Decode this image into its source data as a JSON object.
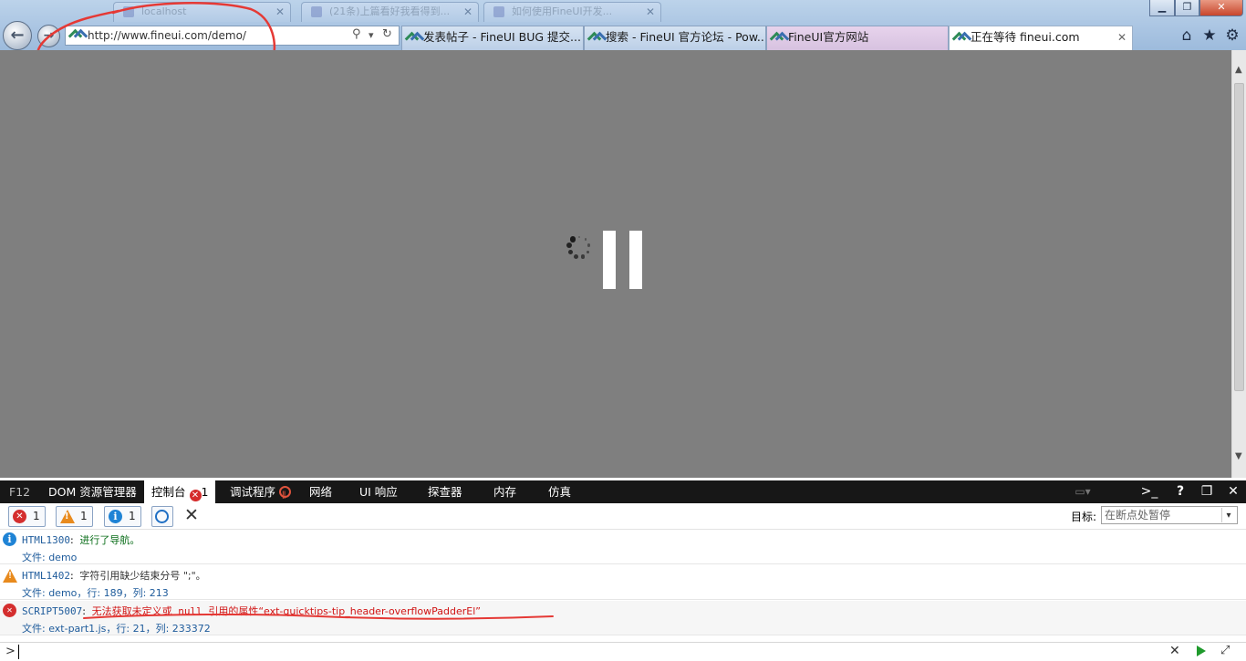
{
  "window": {
    "minimize_glyph": "▁",
    "restore_glyph": "❐",
    "close_glyph": "✕"
  },
  "background_tabs": [
    {
      "label": "localhost"
    },
    {
      "label": "(21条)上篇看好我看得到..."
    },
    {
      "label": "如何使用FineUI开发..."
    }
  ],
  "address_bar": {
    "url": "http://www.fineui.com/demo/",
    "search_glyph": "⚲",
    "dropdown_glyph": "▾",
    "refresh_glyph": "↻"
  },
  "tabs": [
    {
      "label": "发表帖子 - FineUI BUG 提交..."
    },
    {
      "label": "搜索 - FineUI 官方论坛 - Pow..."
    },
    {
      "label": "FineUI官方网站"
    },
    {
      "label": "正在等待 fineui.com",
      "close": "✕"
    }
  ],
  "toolbar_icons": {
    "home": "⌂",
    "favorites": "★",
    "tools": "⚙"
  },
  "colors": {
    "page_overlay": "#7f7f7f",
    "error": "#d42e2e",
    "warning": "#e88a1d",
    "info": "#1f83d5",
    "annotation": "#e53935"
  },
  "devtools": {
    "tabs": {
      "f12": "F12",
      "dom": "DOM 资源管理器",
      "console": "控制台",
      "console_errors": "1",
      "debugger": "调试程序",
      "network": "网络",
      "ui_responsiveness": "UI 响应",
      "profiler": "探查器",
      "memory": "内存",
      "emulation": "仿真"
    },
    "right_icons": {
      "help": "?",
      "undock": "❐",
      "close": "✕"
    },
    "filters": {
      "errors": "1",
      "warnings": "1",
      "info": "1"
    },
    "clear_glyph": "✕",
    "target": {
      "label": "目标:",
      "value": "在断点处暂停",
      "chevron": "▾"
    },
    "messages": [
      {
        "type": "info",
        "code": "HTML1300",
        "text": "进行了导航。",
        "source": "文件: demo"
      },
      {
        "type": "warning",
        "code": "HTML1402",
        "text": "字符引用缺少结束分号 \";\"。",
        "source": "文件: demo，行: 189，列: 213"
      },
      {
        "type": "error",
        "code": "SCRIPT5007",
        "text_a": "无法获取未定义或",
        "text_null": "null",
        "text_b": "引用的属性“ext-quicktips-tip_header-overflowPadderEl”",
        "source": "文件: ext-part1.js，行: 21，列: 233372"
      }
    ],
    "input": {
      "prompt": ">",
      "clear": "✕",
      "multiline": "⤢"
    }
  }
}
